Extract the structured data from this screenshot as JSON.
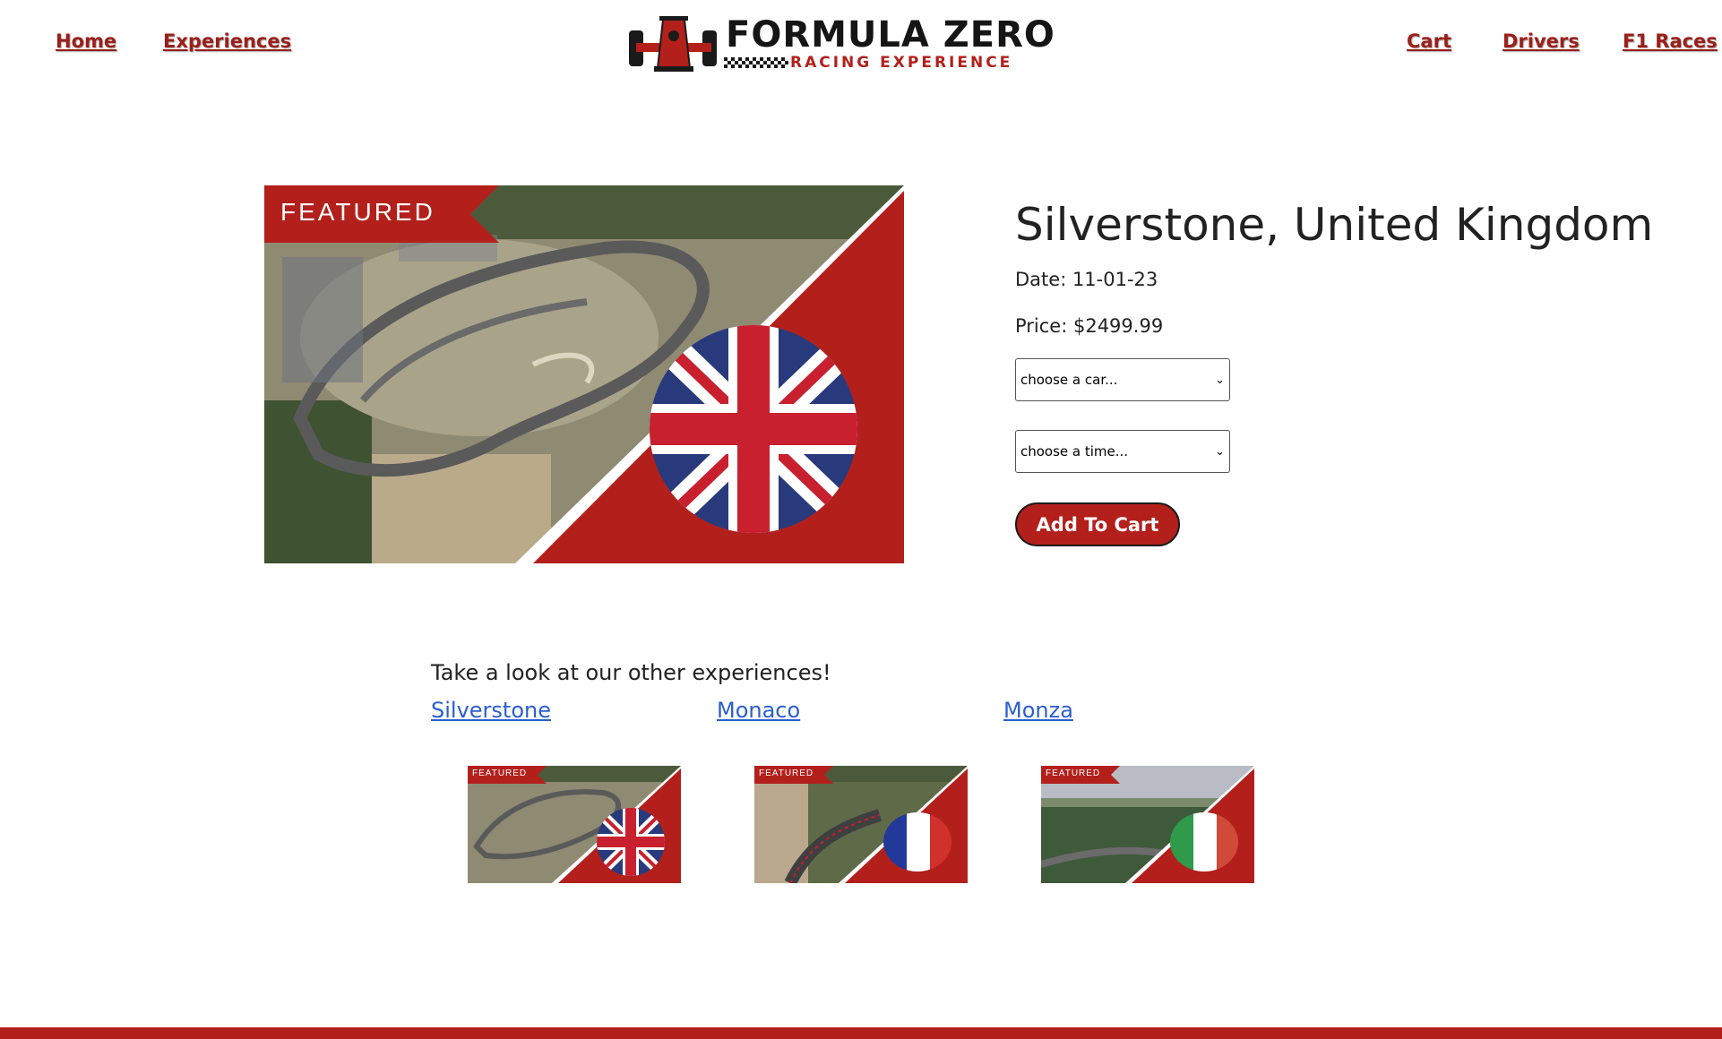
{
  "nav": {
    "home": "Home",
    "experiences": "Experiences",
    "cart": "Cart",
    "drivers": "Drivers",
    "f1_races": "F1 Races"
  },
  "logo": {
    "title": "FORMULA ZERO",
    "subtitle": "RACING EXPERIENCE"
  },
  "hero": {
    "badge": "FEATURED",
    "title": "Silverstone, United Kingdom",
    "date": "Date: 11-01-23",
    "price": "Price: $2499.99",
    "car_select": "choose a car...",
    "time_select": "choose a time...",
    "add_button": "Add To Cart"
  },
  "others": {
    "heading": "Take a look at our other experiences!",
    "items": [
      {
        "label": "Silverstone",
        "badge": "FEATURED",
        "flag": "united-kingdom-flag-icon"
      },
      {
        "label": "Monaco",
        "badge": "FEATURED",
        "flag": "france-flag-icon"
      },
      {
        "label": "Monza",
        "badge": "FEATURED",
        "flag": "italy-flag-icon"
      }
    ]
  },
  "colors": {
    "brand_red": "#b3201c",
    "link_blue": "#2a5ecf",
    "nav_red": "#9c1f1a"
  }
}
